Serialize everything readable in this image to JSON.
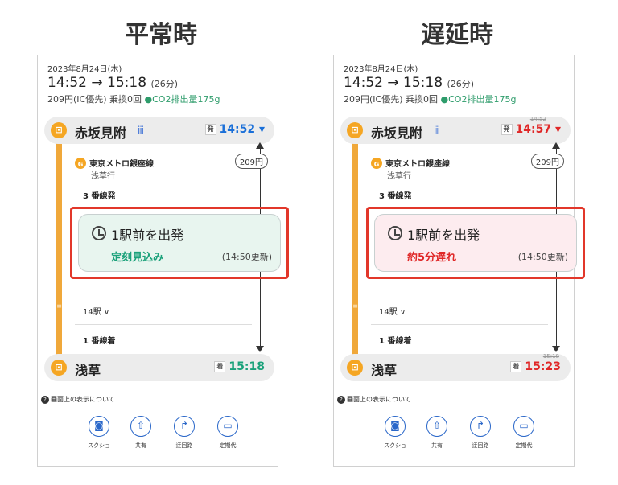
{
  "left": {
    "heading": "平常時",
    "date": "2023年8月24日(木)",
    "time_range": "14:52 → 15:18",
    "duration": "(26分)",
    "fare_prefix": "209円(IC優先) 乗換0回",
    "co2": "CO2排出量175g",
    "origin": {
      "name": "赤坂見附",
      "bars": "iii",
      "dep_label": "発",
      "time": "14:52 ▾"
    },
    "line_badge": "G",
    "line_name": "東京メトロ銀座線",
    "bound": "浅草行",
    "platform_dep": "3 番線発",
    "fare_chip": "209円",
    "status": {
      "title": "1駅前を出発",
      "value": "定刻見込み",
      "updated": "(14:50更新)"
    },
    "stops": "14駅 ∨",
    "platform_arr": "1 番線着",
    "destination": {
      "name": "浅草",
      "arr_label": "着",
      "time": "15:18"
    },
    "about": "画面上の表示について",
    "actions": [
      "スクショ",
      "共有",
      "迂回路",
      "定期代"
    ]
  },
  "right": {
    "heading": "遅延時",
    "date": "2023年8月24日(木)",
    "time_range": "14:52 → 15:18",
    "duration": "(26分)",
    "fare_prefix": "209円(IC優先) 乗換0回",
    "co2": "CO2排出量175g",
    "origin": {
      "name": "赤坂見附",
      "bars": "iii",
      "dep_label": "発",
      "time": "14:57 ▾",
      "scheduled_struck": "14:52"
    },
    "line_badge": "G",
    "line_name": "東京メトロ銀座線",
    "bound": "浅草行",
    "platform_dep": "3 番線発",
    "fare_chip": "209円",
    "status": {
      "title": "1駅前を出発",
      "value": "約5分遅れ",
      "updated": "(14:50更新)"
    },
    "stops": "14駅 ∨",
    "platform_arr": "1 番線着",
    "destination": {
      "name": "浅草",
      "arr_label": "着",
      "time": "15:23",
      "scheduled_struck": "15:18"
    },
    "about": "画面上の表示について",
    "actions": [
      "スクショ",
      "共有",
      "迂回路",
      "定期代"
    ]
  },
  "colors": {
    "on_time": "#1aa17a",
    "delay": "#e02828",
    "highlight_border": "#e2372a",
    "line_accent": "#f0a83a",
    "time_blue": "#1a6fd8"
  },
  "icons": [
    "camera-icon",
    "share-icon",
    "detour-icon",
    "commuter-pass-icon",
    "clock-icon",
    "help-icon",
    "train-icon"
  ]
}
